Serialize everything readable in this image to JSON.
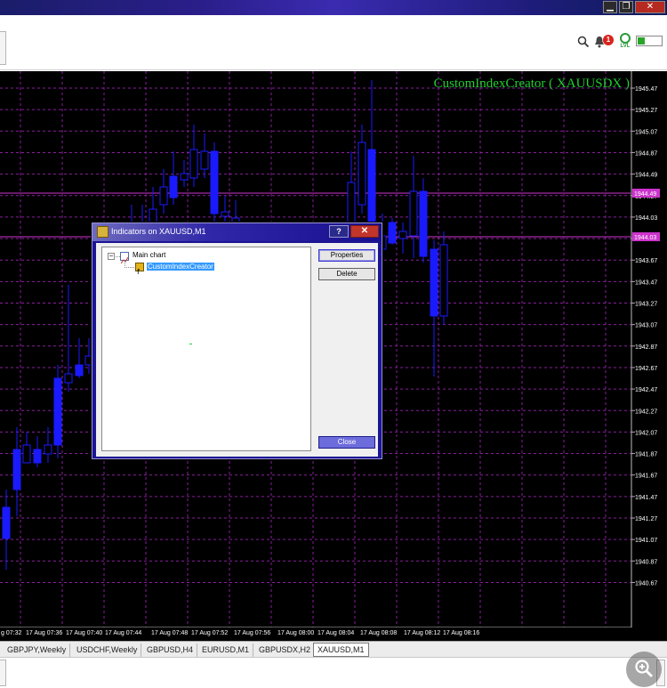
{
  "window": {
    "minimize_glyph": "▁",
    "restore_glyph": "❐",
    "close_glyph": "✕"
  },
  "toolbar": {
    "notification_count": "1",
    "level_label": "LVL",
    "battery_level_percent": 30
  },
  "chart": {
    "indicator_title": "CustomIndexCreator ( XAUUSDX )",
    "background_color": "#000000",
    "grid_color": "#8a1d9e",
    "bull_color": "#1a1aff",
    "price_line_color": "#cc33cc",
    "price_labels": [
      "1945.47",
      "1945.27",
      "1945.07",
      "1944.87",
      "1944.49",
      "1944.27",
      "1944.03",
      "1943.87",
      "1943.67",
      "1943.47",
      "1943.27",
      "1943.07",
      "1942.87",
      "1942.67",
      "1942.47",
      "1942.27",
      "1942.07",
      "1941.87",
      "1941.67",
      "1941.47",
      "1941.27",
      "1941.07",
      "1940.87",
      "1940.67"
    ],
    "level_labels": [
      "1944.49",
      "1944.03"
    ],
    "time_labels": [
      "g 07:32",
      "17 Aug 07:36",
      "17 Aug 07:40",
      "17 Aug 07:44",
      "17 Aug 07:48",
      "17 Aug 07:52",
      "17 Aug 07:56",
      "17 Aug 08:00",
      "17 Aug 08:04",
      "17 Aug 08:08",
      "17 Aug 08:12",
      "17 Aug 08:16"
    ]
  },
  "dialog": {
    "title": "Indicators on XAUUSD,M1",
    "help_label": "?",
    "close_glyph": "✕",
    "tree_root": "Main chart",
    "tree_child": "CustomIndexCreator",
    "expand_glyph": "−",
    "buttons": {
      "properties": "Properties",
      "delete": "Delete",
      "close": "Close"
    }
  },
  "tabs": [
    {
      "label": "GBPJPY,Weekly"
    },
    {
      "label": "USDCHF,Weekly"
    },
    {
      "label": "GBPUSD,H4"
    },
    {
      "label": "EURUSD,M1"
    },
    {
      "label": "GBPUSDX,H2"
    },
    {
      "label": "XAUUSD,M1"
    }
  ]
}
